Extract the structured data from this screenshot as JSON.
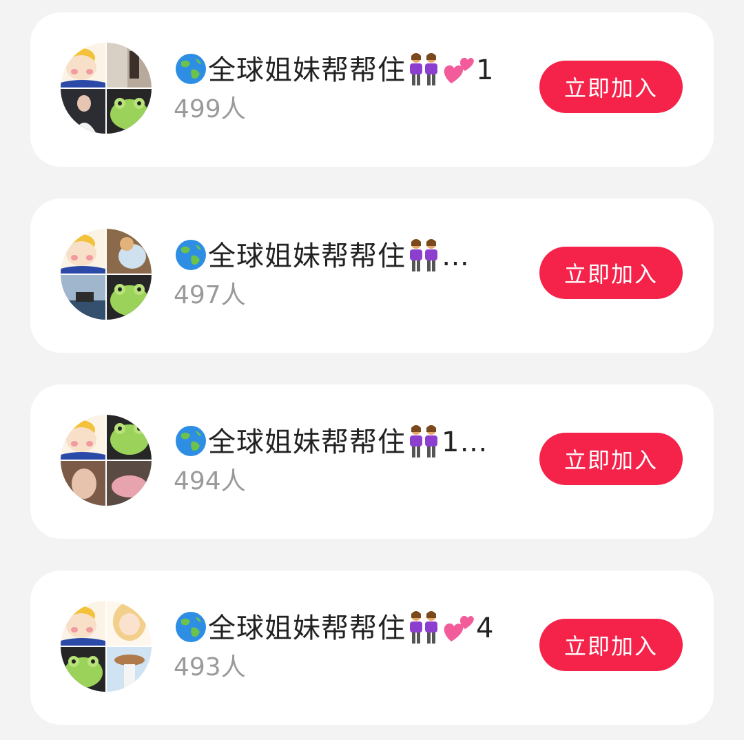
{
  "groups": [
    {
      "name_text": "全球姐妹帮帮住",
      "prefix_icon": "globe-icon",
      "suffix_icons": [
        "two-women-icon",
        "two-hearts-icon"
      ],
      "suffix_text": "1",
      "member_count": "499人",
      "join_label": "立即加入"
    },
    {
      "name_text": "全球姐妹帮帮住",
      "prefix_icon": "globe-icon",
      "suffix_icons": [
        "two-women-icon"
      ],
      "suffix_text": "…",
      "member_count": "497人",
      "join_label": "立即加入"
    },
    {
      "name_text": "全球姐妹帮帮住",
      "prefix_icon": "globe-icon",
      "suffix_icons": [
        "two-women-icon"
      ],
      "suffix_text": "1…",
      "member_count": "494人",
      "join_label": "立即加入"
    },
    {
      "name_text": "全球姐妹帮帮住",
      "prefix_icon": "globe-icon",
      "suffix_icons": [
        "two-women-icon",
        "two-hearts-icon"
      ],
      "suffix_text": "4",
      "member_count": "493人",
      "join_label": "立即加入"
    }
  ],
  "colors": {
    "background": "#f3f3f3",
    "card": "#ffffff",
    "join_button": "#f5234a",
    "join_text": "#ffffff",
    "title_text": "#222222",
    "count_text": "#9a9a9a"
  }
}
